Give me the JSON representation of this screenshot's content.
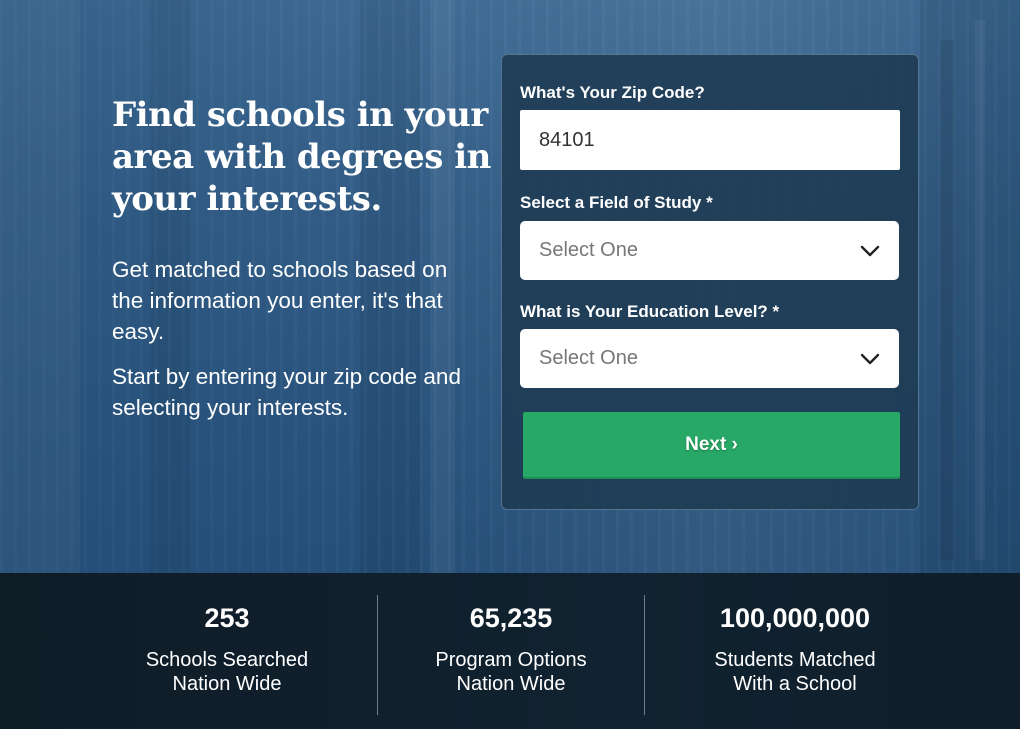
{
  "hero": {
    "headline": "Find schools in your area with degrees in your interests.",
    "paragraph1": "Get matched to schools based on the information you enter, it's that easy.",
    "paragraph2": "Start by entering your zip code and selecting your interests."
  },
  "form": {
    "zip_label": "What's Your Zip Code?",
    "zip_value": "84101",
    "field_label": "Select a Field of Study *",
    "field_selected": "Select One",
    "education_label": "What is Your Education Level? *",
    "education_selected": "Select One",
    "next_label": "Next ›",
    "chevron_icon": "chevron-down-icon",
    "button_color": "#27a866"
  },
  "stats": [
    {
      "number": "253",
      "label": "Schools Searched\nNation Wide"
    },
    {
      "number": "65,235",
      "label": "Program Options\nNation Wide"
    },
    {
      "number": "100,000,000",
      "label": "Students Matched\nWith a School"
    }
  ]
}
